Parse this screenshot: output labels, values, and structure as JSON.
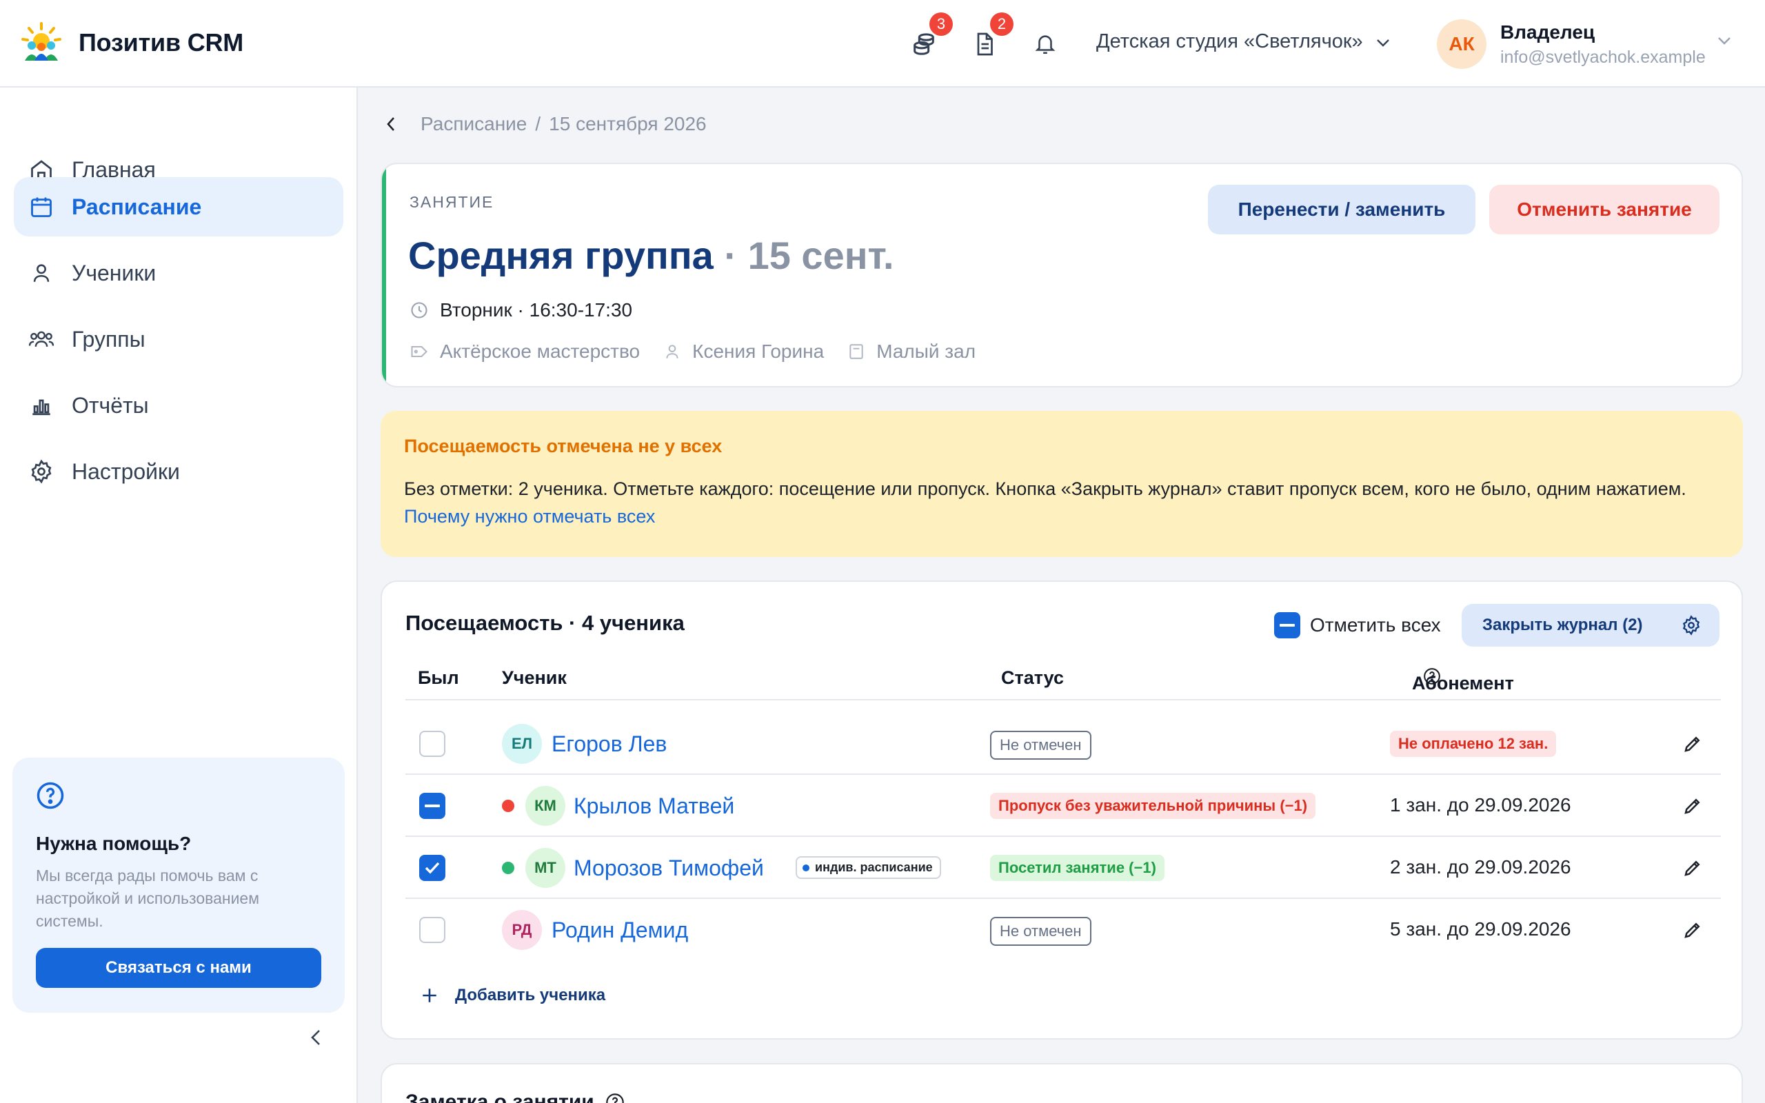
{
  "app": {
    "name": "Позитив CRM"
  },
  "header": {
    "icons": [
      {
        "name": "coins-stack-icon",
        "badge": "3"
      },
      {
        "name": "document-icon",
        "badge": "2"
      },
      {
        "name": "bell-icon",
        "badge": null
      }
    ],
    "studio": "Детская студия «Светлячок»",
    "user": {
      "initials": "АК",
      "role": "Владелец",
      "email": "info@svetlyachok.example"
    }
  },
  "sidebar": {
    "items": [
      {
        "label": "Главная",
        "icon": "home-icon",
        "active": false
      },
      {
        "label": "Расписание",
        "icon": "calendar-icon",
        "active": true
      },
      {
        "label": "Ученики",
        "icon": "user-icon",
        "active": false
      },
      {
        "label": "Группы",
        "icon": "users-icon",
        "active": false
      },
      {
        "label": "Отчёты",
        "icon": "bar-chart-icon",
        "active": false
      },
      {
        "label": "Настройки",
        "icon": "gear-icon",
        "active": false
      }
    ],
    "help": {
      "title": "Нужна помощь?",
      "text": "Мы всегда рады помочь вам с настройкой и использованием системы.",
      "button": "Связаться с нами"
    }
  },
  "breadcrumb": {
    "parent": "Расписание",
    "separator": "/",
    "current": "15 сентября 2026"
  },
  "lesson": {
    "kicker": "ЗАНЯТИЕ",
    "group": "Средняя группа",
    "date_suffix": "· 15 сент.",
    "time": "Вторник · 16:30-17:30",
    "subject": "Актёрское мастерство",
    "teacher": "Ксения Горина",
    "room": "Малый зал",
    "move_button": "Перенести / заменить",
    "cancel_button": "Отменить занятие"
  },
  "alert": {
    "title": "Посещаемость отмечена не у всех",
    "text": "Без отметки: 2 ученика. Отметьте каждого: посещение или пропуск. Кнопка «Закрыть журнал» ставит пропуск всем, кого не было, одним нажатием.",
    "link": "Почему нужно отмечать всех"
  },
  "attendance": {
    "title": "Посещаемость · 4 ученика",
    "mark_all": "Отметить всех",
    "close_journal": "Закрыть журнал (2)",
    "columns": {
      "present": "Был",
      "student": "Ученик",
      "status": "Статус",
      "subscription": "Абонемент"
    },
    "rows": [
      {
        "check": "off",
        "dot": null,
        "initials": "ЕЛ",
        "name": "Егоров Лев",
        "tag": null,
        "status": "Не отмечен",
        "status_kind": "none",
        "subscription": "Не оплачено 12 зан.",
        "subscription_kind": "unpaid"
      },
      {
        "check": "partial",
        "dot": "#f04438",
        "initials": "КМ",
        "name": "Крылов Матвей",
        "tag": null,
        "status": "Пропуск без уважительной причины (−1)",
        "status_kind": "absent",
        "subscription": "1 зан. до 29.09.2026",
        "subscription_kind": "normal"
      },
      {
        "check": "on",
        "dot": "#2bb673",
        "initials": "МТ",
        "name": "Морозов Тимофей",
        "tag": "индив. расписание",
        "status": "Посетил занятие (−1)",
        "status_kind": "visited",
        "subscription": "2 зан. до 29.09.2026",
        "subscription_kind": "normal"
      },
      {
        "check": "off",
        "dot": null,
        "initials": "РД",
        "name": "Родин Демид",
        "tag": null,
        "status": "Не отмечен",
        "status_kind": "none",
        "subscription": "5 зан. до 29.09.2026",
        "subscription_kind": "normal"
      }
    ],
    "add_student": "Добавить ученика"
  },
  "notes": {
    "title": "Заметка о занятии"
  },
  "colors": {
    "accent": "#1667d9",
    "success": "#2bb673",
    "danger": "#d92d20",
    "warning_bg": "#fef1bf"
  }
}
